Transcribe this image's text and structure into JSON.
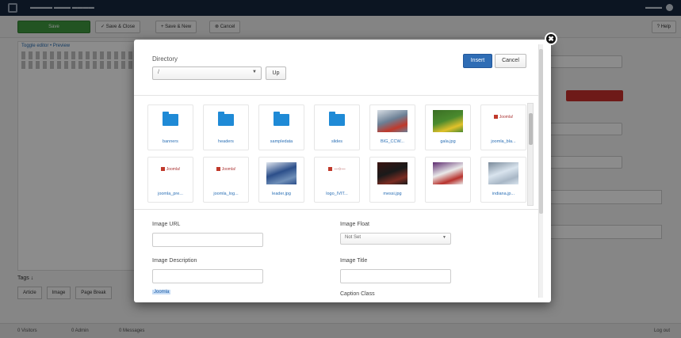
{
  "dialog": {
    "directory_label": "Directory",
    "directory_value": "/",
    "up_label": "Up",
    "insert_label": "Insert",
    "cancel_label": "Cancel",
    "close_glyph": "✖"
  },
  "thumbnails": [
    {
      "kind": "folder",
      "caption": "banners"
    },
    {
      "kind": "folder",
      "caption": "headers"
    },
    {
      "kind": "folder",
      "caption": "sampledata"
    },
    {
      "kind": "folder",
      "caption": "slides"
    },
    {
      "kind": "image",
      "caption": "BIG_CCW...",
      "colors": [
        "#6b7f95",
        "#c0392b",
        "#d7dde4"
      ]
    },
    {
      "kind": "image",
      "caption": "gala.jpg",
      "colors": [
        "#4a8a2e",
        "#e2c12a",
        "#3a6d24"
      ]
    },
    {
      "kind": "logo",
      "caption": "joomla_bla...",
      "logo_text": "Joomla!"
    },
    {
      "kind": "logo",
      "caption": "joomla_pre...",
      "logo_text": "Joomla!"
    },
    {
      "kind": "logo",
      "caption": "joomla_log...",
      "logo_text": "Joomla!"
    },
    {
      "kind": "image",
      "caption": "leader.jpg",
      "colors": [
        "#2c4f8a",
        "#6f8fb8",
        "#dfe5ee"
      ]
    },
    {
      "kind": "logo",
      "caption": "logo_IVIT...",
      "logo_text": "—✩—"
    },
    {
      "kind": "image",
      "caption": "messi.jpg",
      "colors": [
        "#1a1a1a",
        "#7a2c22",
        "#3a1410"
      ]
    },
    {
      "kind": "image",
      "caption": "",
      "colors": [
        "#e9e9e9",
        "#b8332e",
        "#5c2a6e"
      ]
    },
    {
      "kind": "image",
      "caption": "indiana.jp...",
      "colors": [
        "#d9e4ee",
        "#a8b7c6",
        "#7a8a9a"
      ]
    }
  ],
  "form": {
    "image_url_label": "Image URL",
    "image_float_label": "Image Float",
    "image_float_value": "Not Set",
    "image_description_label": "Image Description",
    "image_title_label": "Image Title",
    "selected_text": "Joomla",
    "caption_class_label": "Caption Class"
  },
  "background": {
    "save_label": "Save",
    "save_close_label": "✓ Save & Close",
    "save_new_label": "+ Save & New",
    "cancel_label": "⊗ Cancel",
    "help_label": "? Help",
    "editor_tabs": "Toggle editor  • Preview",
    "tags_label": "Tags ↓",
    "bottom_btn1": "Article",
    "bottom_btn2": "Image",
    "bottom_btn3": "Page Break",
    "status1": "0 Visitors",
    "status2": "0 Admin",
    "status3": "0 Messages",
    "status4": "Log out"
  },
  "colors": {
    "primary": "#2f6db5",
    "folder": "#1f8ad6",
    "link": "#2a6fb5"
  }
}
